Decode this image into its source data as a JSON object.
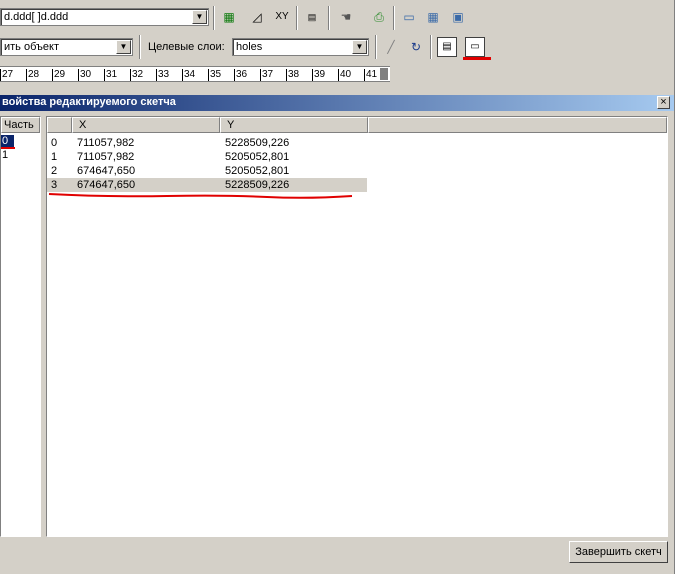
{
  "toolbar1": {
    "layer_combo_value": "d.ddd[ ]d.ddd",
    "buttons": [
      "layer-properties-icon",
      "eraser-icon",
      "xy-icon",
      "grid-icon",
      "hand-icon",
      "print-icon",
      "window-icon",
      "table-icon",
      "layout-icon"
    ]
  },
  "toolbar2": {
    "task_combo_value": "ить объект",
    "target_label": "Целевые слои:",
    "target_combo_value": "holes"
  },
  "ruler": {
    "ticks": [
      "27",
      "28",
      "29",
      "30",
      "31",
      "32",
      "33",
      "34",
      "35",
      "36",
      "37",
      "38",
      "39",
      "40",
      "41"
    ]
  },
  "dialog": {
    "title": "войства редактируемого скетча",
    "close_glyph": "×",
    "parts_header": "Часть",
    "parts": [
      "0",
      "1"
    ],
    "table": {
      "columns": [
        "",
        "X",
        "Y"
      ],
      "rows": [
        [
          "0",
          "711057,982",
          "5228509,226"
        ],
        [
          "1",
          "711057,982",
          "5205052,801"
        ],
        [
          "2",
          "674647,650",
          "5205052,801"
        ],
        [
          "3",
          "674647,650",
          "5228509,226"
        ]
      ]
    },
    "finish_button": "Завершить скетч"
  },
  "colors": {
    "title_start": "#0a246a",
    "title_end": "#a6caf0",
    "annotation_red": "#e00000",
    "selected_row": "#d4d0c8"
  }
}
